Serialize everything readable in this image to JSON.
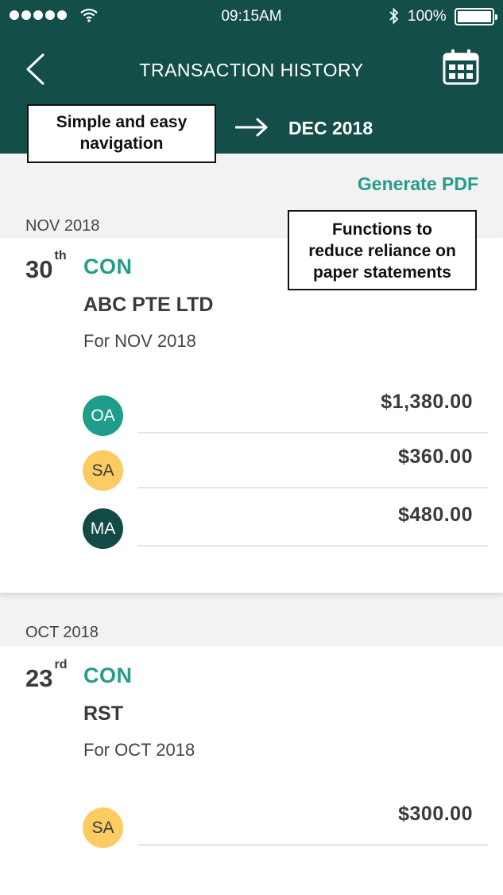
{
  "status_bar": {
    "time": "09:15AM",
    "battery": "100%"
  },
  "header": {
    "title": "TRANSACTION HISTORY",
    "current_month": "DEC 2018"
  },
  "callouts": {
    "navigation": [
      "Simple and easy",
      "navigation"
    ],
    "paper": [
      "Functions to",
      "reduce reliance on",
      "paper statements"
    ]
  },
  "actions": {
    "generate_pdf": "Generate PDF"
  },
  "colors": {
    "header_bg": "#144e48",
    "accent": "#239c88",
    "oa": "#1f9d8a",
    "sa": "#fccb62",
    "ma": "#134a45"
  },
  "sections": [
    {
      "label": "NOV 2018",
      "day": "30",
      "suffix": "th",
      "type": "CON",
      "payer": "ABC PTE LTD",
      "period": "For NOV 2018",
      "accounts": [
        {
          "code": "OA",
          "amount": "$1,380.00"
        },
        {
          "code": "SA",
          "amount": "$360.00"
        },
        {
          "code": "MA",
          "amount": "$480.00"
        }
      ]
    },
    {
      "label": "OCT 2018",
      "day": "23",
      "suffix": "rd",
      "type": "CON",
      "payer": "RST",
      "period": "For OCT 2018",
      "accounts": [
        {
          "code": "SA",
          "amount": "$300.00"
        }
      ]
    }
  ]
}
